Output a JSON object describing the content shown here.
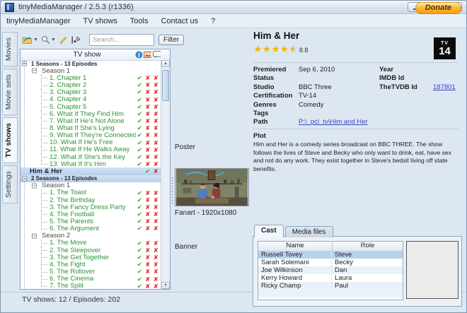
{
  "window": {
    "title": "tinyMediaManager / 2.5.3 (r1336)"
  },
  "menu": {
    "items": [
      "tinyMediaManager",
      "TV shows",
      "Tools",
      "Contact us",
      "?"
    ],
    "donate_label": "Donate"
  },
  "side_tabs": {
    "items": [
      {
        "label": "Movies",
        "state": ""
      },
      {
        "label": "Movie sets",
        "state": ""
      },
      {
        "label": "TV shows",
        "state": "active"
      },
      {
        "label": "Settings",
        "state": ""
      }
    ]
  },
  "toolbar": {
    "search_placeholder": "Search...",
    "filter_label": "Filter"
  },
  "tree": {
    "header": "TV show",
    "rows": [
      {
        "cls": "t-sub",
        "label": "1 Seasons - 13 Episodes",
        "i": []
      },
      {
        "cls": "t-season",
        "label": "Season 1",
        "i": []
      },
      {
        "cls": "t-episode",
        "label": "1. Chapter 1",
        "i": [
          "check",
          "x",
          "x"
        ]
      },
      {
        "cls": "t-episode",
        "label": "2. Chapter 2",
        "i": [
          "check",
          "x",
          "x"
        ]
      },
      {
        "cls": "t-episode",
        "label": "3. Chapter 3",
        "i": [
          "check",
          "x",
          "x"
        ]
      },
      {
        "cls": "t-episode",
        "label": "4. Chapter 4",
        "i": [
          "check",
          "x",
          "x"
        ]
      },
      {
        "cls": "t-episode",
        "label": "5. Chapter 5",
        "i": [
          "check",
          "x",
          "x"
        ]
      },
      {
        "cls": "t-episode",
        "label": "6. What If They Find Him",
        "i": [
          "check",
          "x",
          "x"
        ]
      },
      {
        "cls": "t-episode",
        "label": "7. What If He's Not Alone",
        "i": [
          "check",
          "x",
          "x"
        ]
      },
      {
        "cls": "t-episode",
        "label": "8. What If She's Lying",
        "i": [
          "check",
          "x",
          "x"
        ]
      },
      {
        "cls": "t-episode",
        "label": "9. What If They're Connected",
        "i": [
          "check",
          "x",
          "x"
        ]
      },
      {
        "cls": "t-episode",
        "label": "10. What If He's Free",
        "i": [
          "check",
          "x",
          "x"
        ]
      },
      {
        "cls": "t-episode",
        "label": "11. What If He Walks Away",
        "i": [
          "check",
          "x",
          "x"
        ]
      },
      {
        "cls": "t-episode",
        "label": "12. What If She's the Key",
        "i": [
          "check",
          "x",
          "x"
        ]
      },
      {
        "cls": "t-episode t-last",
        "label": "13. What If It's Him",
        "i": [
          "check",
          "x",
          "x"
        ]
      },
      {
        "cls": "t-show t-selected",
        "label": "Him & Her",
        "i": [
          "check",
          "x"
        ]
      },
      {
        "cls": "t-sub t-selected",
        "label": "2 Seasons - 13 Episodes",
        "i": []
      },
      {
        "cls": "t-season",
        "label": "Season 1",
        "i": []
      },
      {
        "cls": "t-episode",
        "label": "1. The Toast",
        "i": [
          "check",
          "x",
          "x"
        ]
      },
      {
        "cls": "t-episode",
        "label": "2. The Birthday",
        "i": [
          "check",
          "x",
          "x"
        ]
      },
      {
        "cls": "t-episode",
        "label": "3. The Fancy Dress Party",
        "i": [
          "check",
          "x",
          "x"
        ]
      },
      {
        "cls": "t-episode",
        "label": "4. The Football",
        "i": [
          "check",
          "x",
          "x"
        ]
      },
      {
        "cls": "t-episode",
        "label": "5. The Parents",
        "i": [
          "check",
          "x",
          "x"
        ]
      },
      {
        "cls": "t-episode t-last",
        "label": "6. The Argument",
        "i": [
          "check",
          "x",
          "x"
        ]
      },
      {
        "cls": "t-season",
        "label": "Season 2",
        "i": []
      },
      {
        "cls": "t-episode",
        "label": "1. The Move",
        "i": [
          "check",
          "x",
          "x"
        ]
      },
      {
        "cls": "t-episode",
        "label": "2. The Sleepover",
        "i": [
          "check",
          "x",
          "x"
        ]
      },
      {
        "cls": "t-episode",
        "label": "3. The Get Together",
        "i": [
          "check",
          "x",
          "x"
        ]
      },
      {
        "cls": "t-episode",
        "label": "4. The Fight",
        "i": [
          "check",
          "x",
          "x"
        ]
      },
      {
        "cls": "t-episode",
        "label": "5. The Rollover",
        "i": [
          "check",
          "x",
          "x"
        ]
      },
      {
        "cls": "t-episode",
        "label": "6. The Cinema",
        "i": [
          "check",
          "x",
          "x"
        ]
      },
      {
        "cls": "t-episode t-last",
        "label": "7. The Split",
        "i": [
          "check",
          "x",
          "x"
        ]
      }
    ]
  },
  "statusbar": {
    "text": "TV shows:  12  /  Episodes:  202"
  },
  "media_column": {
    "poster_label": "Poster",
    "fanart_label": "Fanart - 1920x1080",
    "banner_label": "Banner"
  },
  "details": {
    "title": "Him & Her",
    "rating": {
      "stars": 4.5,
      "value": "8.8"
    },
    "certification_badge": {
      "top": "TV",
      "bottom": "14"
    },
    "fields": {
      "premiered_label": "Premiered",
      "premiered": "Sep 6, 2010",
      "year_label": "Year",
      "year": "",
      "status_label": "Status",
      "status": "",
      "imdb_label": "IMDB Id",
      "imdb": "",
      "studio_label": "Studio",
      "studio": "BBC Three",
      "tvdb_label": "TheTVDB Id",
      "tvdb": "187801",
      "cert_label": "Certification",
      "cert": "TV-14",
      "genres_label": "Genres",
      "genres": "Comedy",
      "tags_label": "Tags",
      "tags": "",
      "path_label": "Path",
      "path": "P:\\_pcl_tv\\Him and Her"
    },
    "plot_label": "Plot",
    "plot": "Him and Her is a comedy series broadcast on BBC THREE. The show follows the lives of Steve and Becky who only want to drink, eat, have sex and not do any work. They exist together in Steve's bedsit living off state benefits."
  },
  "cast_panel": {
    "tabs": [
      {
        "label": "Cast",
        "state": "active"
      },
      {
        "label": "Media files",
        "state": ""
      }
    ],
    "columns": {
      "name": "Name",
      "role": "Role"
    },
    "rows": [
      {
        "name": "Russell Tovey",
        "role": "Steve",
        "cls": "selected"
      },
      {
        "name": "Sarah Solemani",
        "role": "Becky",
        "cls": ""
      },
      {
        "name": "Joe Wilkinson",
        "role": "Dan",
        "cls": ""
      },
      {
        "name": "Kerry Howard",
        "role": "Laura",
        "cls": ""
      },
      {
        "name": "Ricky Champ",
        "role": "Paul",
        "cls": ""
      }
    ]
  },
  "colors": {
    "episode_green": "#2e9137",
    "check_green": "#3aa330",
    "x_red": "#d92b2b",
    "link_blue": "#3846c8",
    "selection_blue": "#b7cfeb",
    "donate_orange": "#f49d14"
  }
}
